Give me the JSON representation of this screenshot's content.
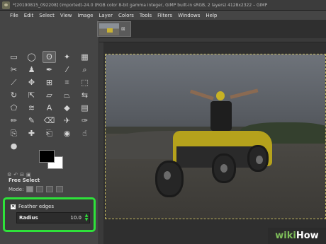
{
  "window": {
    "title": "*[20190815_092208] (imported)-24.0 (RGB color 8-bit gamma integer, GIMP built-in sRGB, 2 layers) 4128x2322 – GIMP"
  },
  "menu": [
    "File",
    "Edit",
    "Select",
    "View",
    "Image",
    "Layer",
    "Colors",
    "Tools",
    "Filters",
    "Windows",
    "Help"
  ],
  "tools": [
    {
      "icon": "rect-select-icon",
      "glyph": "▭"
    },
    {
      "icon": "ellipse-select-icon",
      "glyph": "◯"
    },
    {
      "icon": "free-select-icon",
      "glyph": "ʘ",
      "active": true
    },
    {
      "icon": "fuzzy-select-icon",
      "glyph": "✦"
    },
    {
      "icon": "color-select-icon",
      "glyph": "▦"
    },
    {
      "icon": "scissors-icon",
      "glyph": "✂"
    },
    {
      "icon": "foreground-select-icon",
      "glyph": "♟"
    },
    {
      "icon": "paths-icon",
      "glyph": "✒"
    },
    {
      "icon": "color-picker-icon",
      "glyph": "⁄"
    },
    {
      "icon": "zoom-icon",
      "glyph": "⌕"
    },
    {
      "icon": "measure-icon",
      "glyph": "⟋"
    },
    {
      "icon": "move-icon",
      "glyph": "✥"
    },
    {
      "icon": "align-icon",
      "glyph": "⊞"
    },
    {
      "icon": "crop-icon",
      "glyph": "⌗"
    },
    {
      "icon": "unified-transform-icon",
      "glyph": "⬚"
    },
    {
      "icon": "rotate-icon",
      "glyph": "↻"
    },
    {
      "icon": "scale-icon",
      "glyph": "⇱"
    },
    {
      "icon": "shear-icon",
      "glyph": "▱"
    },
    {
      "icon": "perspective-icon",
      "glyph": "⏢"
    },
    {
      "icon": "flip-icon",
      "glyph": "⇆"
    },
    {
      "icon": "cage-icon",
      "glyph": "⬠"
    },
    {
      "icon": "warp-icon",
      "glyph": "≋"
    },
    {
      "icon": "text-icon",
      "glyph": "A"
    },
    {
      "icon": "bucket-fill-icon",
      "glyph": "◆"
    },
    {
      "icon": "gradient-icon",
      "glyph": "▤"
    },
    {
      "icon": "pencil-icon",
      "glyph": "✏"
    },
    {
      "icon": "paintbrush-icon",
      "glyph": "✎"
    },
    {
      "icon": "eraser-icon",
      "glyph": "⌫"
    },
    {
      "icon": "airbrush-icon",
      "glyph": "✈"
    },
    {
      "icon": "ink-icon",
      "glyph": "✑"
    },
    {
      "icon": "clone-icon",
      "glyph": "⎘"
    },
    {
      "icon": "heal-icon",
      "glyph": "✚"
    },
    {
      "icon": "perspective-clone-icon",
      "glyph": "⎗"
    },
    {
      "icon": "blur-icon",
      "glyph": "◉"
    },
    {
      "icon": "smudge-icon",
      "glyph": "☝"
    },
    {
      "icon": "dodge-burn-icon",
      "glyph": "●"
    }
  ],
  "tool_options": {
    "title": "Free Select",
    "mode_label": "Mode:",
    "feather_checkbox": "✕",
    "feather_label": "Feather edges",
    "radius_label": "Radius",
    "radius_value": "10.0",
    "stepper_up": "▲",
    "stepper_down": "▼"
  },
  "image_tab": {
    "close": "⊠"
  },
  "watermark": {
    "wiki": "wiki",
    "how": "How"
  },
  "colors": {
    "highlight": "#2ee23a",
    "foreground": "#000000",
    "background": "#ffffff"
  }
}
